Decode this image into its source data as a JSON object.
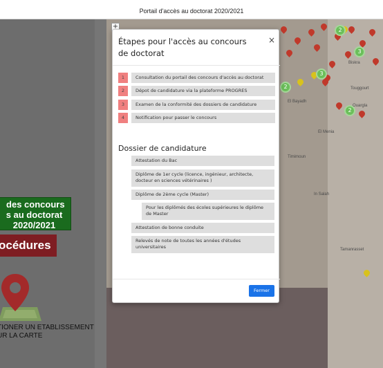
{
  "header": {
    "title": "Portail d'accès au doctorat 2020/2021"
  },
  "left_panel": {
    "banner_text": " des concours\ns au doctorat\n2020/2021",
    "procedures_label": "océdures",
    "select_link_text": "TIONER UN ETABLISSEMENT\nUR LA CARTE"
  },
  "map": {
    "zoom_in_label": "+",
    "clusters": [
      "3",
      "3",
      "2",
      "2",
      "2"
    ],
    "labels": [
      "Biskra",
      "Touggourt",
      "Ouargla",
      "El Bayadh",
      "Timimoun",
      "Tamanrasset",
      "In Salah",
      "El Menia"
    ]
  },
  "modal": {
    "title": "Étapes pour l'accès au concours de doctorat",
    "close_label": "×",
    "steps": [
      {
        "number": "1",
        "text": "Consultation du portail des concours d'accès au doctorat"
      },
      {
        "number": "2",
        "text": "Dépot de candidature via la plateforme PROGRES"
      },
      {
        "number": "3",
        "text": "Examen de la conformité des dossiers de candidature"
      },
      {
        "number": "4",
        "text": "Notification pour passer le concours"
      }
    ],
    "dossier_title": "Dossier de candidature",
    "dossier_items": [
      "Attestation du Bac",
      "Diplôme de 1er cycle (licence, ingénieur, architecte, docteur en sciences vétérinaires )",
      "Diplôme de 2ème cycle (Master)",
      "Pour les diplômés des écoles supérieures le diplôme de Master",
      "Attestation de bonne conduite",
      "Relevés de note de toutes les années d'études universitaires"
    ],
    "fermer_label": "Fermer"
  },
  "colors": {
    "step_number_bg": "#f08080",
    "item_bg": "#dedede",
    "primary_button": "#1a73e8",
    "banner_green": "#1a6b1e",
    "procedures_red": "#7e1d22",
    "marker_red": "#c0392b",
    "marker_yellow": "#d8c21c",
    "cluster_green": "#6bbf5a"
  }
}
